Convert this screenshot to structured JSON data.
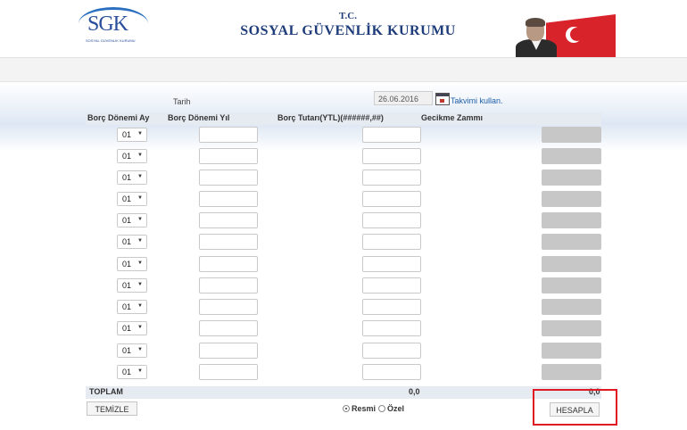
{
  "header": {
    "logo_text": "SGK",
    "logo_subtext": "SOSYAL GÜVENLİK KURUMU",
    "tc": "T.C.",
    "institution": "SOSYAL GÜVENLİK KURUMU"
  },
  "form": {
    "date_label": "Tarih",
    "date_value": "26.06.2016",
    "calendar_link": "Takvimi kullan."
  },
  "table": {
    "headers": [
      "Borç Dönemi Ay",
      "Borç Dönemi Yıl",
      "Borç Tutarı(YTL)(######,##)",
      "Gecikme Zammı"
    ],
    "rows": [
      {
        "month": "01"
      },
      {
        "month": "01"
      },
      {
        "month": "01"
      },
      {
        "month": "01"
      },
      {
        "month": "01"
      },
      {
        "month": "01"
      },
      {
        "month": "01"
      },
      {
        "month": "01"
      },
      {
        "month": "01"
      },
      {
        "month": "01"
      },
      {
        "month": "01"
      },
      {
        "month": "01"
      }
    ]
  },
  "totals": {
    "label": "TOPLAM",
    "debt_total": "0,0",
    "penalty_total": "0,0"
  },
  "actions": {
    "clear_label": "TEMİZLE",
    "calculate_label": "HESAPLA",
    "radio_official": "Resmi",
    "radio_special": "Özel",
    "selected": "Resmi"
  },
  "colors": {
    "brand_blue": "#1f3d7a",
    "highlight_red": "#e01a22"
  }
}
